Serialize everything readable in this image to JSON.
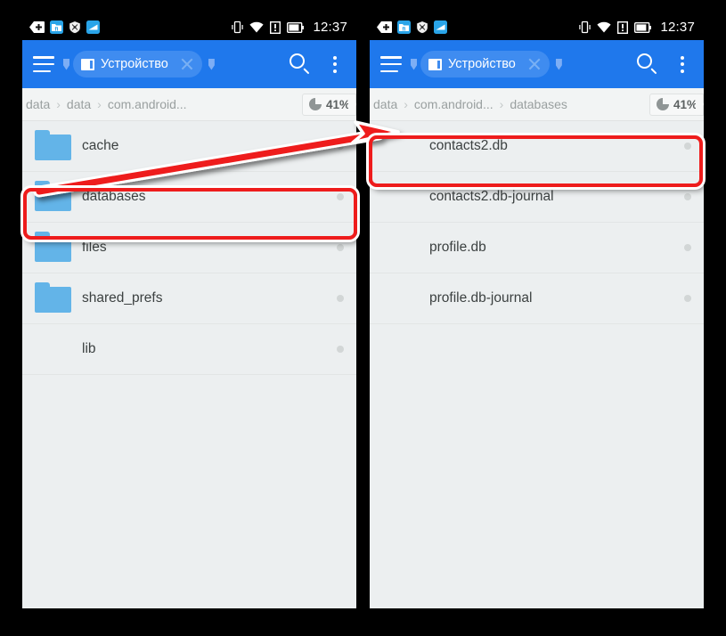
{
  "panels": [
    {
      "id": "left",
      "statusbar": {
        "left_icons": [
          "back-pill-icon",
          "file-manager-icon",
          "shield-icon",
          "gallery-icon"
        ],
        "right_icons": [
          "vibrate-icon",
          "wifi-icon",
          "sim-alert-icon",
          "battery-icon"
        ],
        "clock": "12:37"
      },
      "toolbar": {
        "menu_icon": "hamburger-icon",
        "tab_marker_icon": "bookmark-marker-icon",
        "chip_icon": "sd-card-icon",
        "chip_label": "Устройство",
        "chip_close_icon": "close-icon",
        "tab_end_icon": "bookmark-marker-icon",
        "search_icon": "search-icon",
        "overflow_icon": "overflow-menu-icon"
      },
      "breadcrumb": {
        "items": [
          "data",
          "data",
          "com.android..."
        ],
        "separator": "›",
        "storage_icon": "pie-chart-icon",
        "storage_value": "41%"
      },
      "files": [
        {
          "name": "cache",
          "type": "folder",
          "icon": "folder-icon"
        },
        {
          "name": "databases",
          "type": "folder",
          "icon": "folder-icon"
        },
        {
          "name": "files",
          "type": "folder",
          "icon": "folder-icon"
        },
        {
          "name": "shared_prefs",
          "type": "folder",
          "icon": "folder-icon"
        },
        {
          "name": "lib",
          "type": "file",
          "icon": "unknown-file-icon",
          "glyph": "?"
        }
      ]
    },
    {
      "id": "right",
      "statusbar": {
        "left_icons": [
          "back-pill-icon",
          "file-manager-icon",
          "shield-icon",
          "gallery-icon"
        ],
        "right_icons": [
          "vibrate-icon",
          "wifi-icon",
          "sim-alert-icon",
          "battery-icon"
        ],
        "clock": "12:37"
      },
      "toolbar": {
        "menu_icon": "hamburger-icon",
        "tab_marker_icon": "bookmark-marker-icon",
        "chip_icon": "sd-card-icon",
        "chip_label": "Устройство",
        "chip_close_icon": "close-icon",
        "tab_end_icon": "bookmark-marker-icon",
        "search_icon": "search-icon",
        "overflow_icon": "overflow-menu-icon"
      },
      "breadcrumb": {
        "items": [
          "data",
          "com.android...",
          "databases"
        ],
        "separator": "›",
        "storage_icon": "pie-chart-icon",
        "storage_value": "41%"
      },
      "files": [
        {
          "name": "contacts2.db",
          "type": "file",
          "icon": "unknown-file-icon",
          "glyph": "?"
        },
        {
          "name": "contacts2.db-journal",
          "type": "file",
          "icon": "unknown-file-icon",
          "glyph": "?"
        },
        {
          "name": "profile.db",
          "type": "file",
          "icon": "unknown-file-icon",
          "glyph": "?"
        },
        {
          "name": "profile.db-journal",
          "type": "file",
          "icon": "unknown-file-icon",
          "glyph": "?"
        }
      ]
    }
  ],
  "annotations": {
    "highlight_color": "#ee1c1c",
    "boxes": [
      {
        "target": "databases-row",
        "panel": "left"
      },
      {
        "target": "contacts2.db-row",
        "panel": "right"
      }
    ],
    "arrow": {
      "from": "databases-row",
      "to": "contacts2.db-row"
    }
  }
}
